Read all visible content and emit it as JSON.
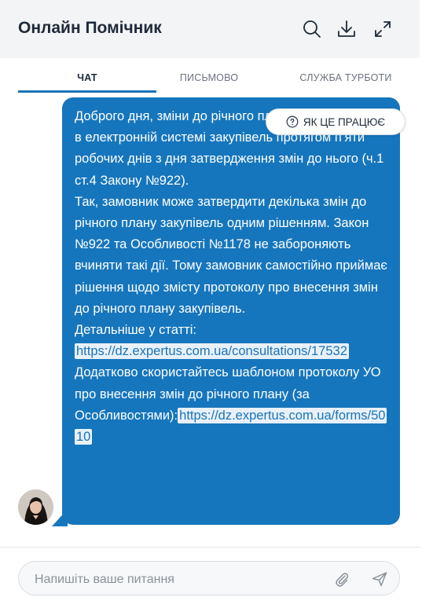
{
  "header": {
    "title": "Онлайн Помічник",
    "icons": [
      "search-icon",
      "download-icon",
      "expand-icon"
    ]
  },
  "tabs": [
    {
      "label": "ЧАТ",
      "active": true
    },
    {
      "label": "ПИСЬМОВО",
      "active": false
    },
    {
      "label": "СЛУЖБА ТУРБОТИ",
      "active": false
    }
  ],
  "how_it_works": {
    "label": "ЯК ЦЕ ПРАЦЮЄ",
    "icon": "help-circle-icon"
  },
  "message": {
    "p1": "Доброго дня, зміни до річного плану оприлюднюйте в електронній системі закупівель протягом п’яти робочих днів з дня затвердження змін до нього (ч.1 ст.4 Закону №922).",
    "p2": "Так, замовник може затвердити декілька змін до річного плану закупівель одним рішенням. Закон №922 та Особливості №1178 не забороняють вчиняти такі дії. Тому замовник самостійно приймає рішення щодо змісту протоколу про внесення змін до річного плану закупівель.",
    "p3": "Детальніше у статті:",
    "link1": "https://dz.expertus.com.ua/consultations/17532",
    "p4": "Додатково скористайтесь шаблоном протоколу УО про внесення змін до річного плану (за Особливостями):",
    "link2": "https://dz.expertus.com.ua/forms/5010"
  },
  "input": {
    "placeholder": "Напишіть ваше питання",
    "value": ""
  },
  "colors": {
    "accent": "#1676bd",
    "header_bg": "#f3f4f6",
    "link_bg": "#e8f1fa"
  }
}
